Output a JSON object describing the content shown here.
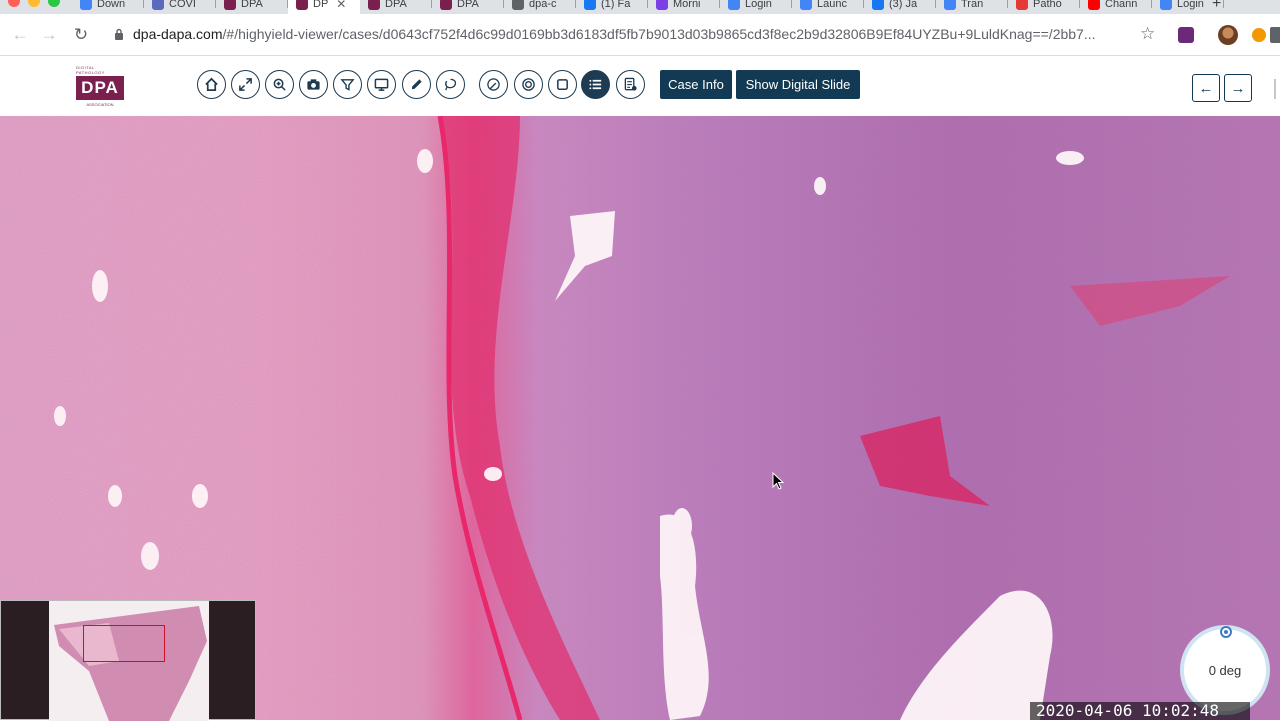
{
  "browser": {
    "tabs": [
      {
        "label": "Down",
        "color": "#4285f4"
      },
      {
        "label": "COVI",
        "color": "#5b6abf"
      },
      {
        "label": "DPA",
        "color": "#7a1f4e"
      },
      {
        "label": "DP",
        "color": "#7a1f4e",
        "active": true
      },
      {
        "label": "DPA",
        "color": "#7a1f4e"
      },
      {
        "label": "DPA",
        "color": "#7a1f4e"
      },
      {
        "label": "dpa-c",
        "color": "#5f6368"
      },
      {
        "label": "(1) Fa",
        "color": "#1877f2"
      },
      {
        "label": "Morni",
        "color": "#7b3fe4"
      },
      {
        "label": "Login",
        "color": "#4285f4"
      },
      {
        "label": "Launc",
        "color": "#4285f4"
      },
      {
        "label": "(3) Ja",
        "color": "#1877f2"
      },
      {
        "label": "Tran",
        "color": "#4285f4"
      },
      {
        "label": "Patho",
        "color": "#e53935"
      },
      {
        "label": "Chann",
        "color": "#ff0000"
      },
      {
        "label": "Login",
        "color": "#4285f4"
      }
    ],
    "new_tab": "+",
    "close_glyph": "✕",
    "url_domain": "dpa-dapa.com",
    "url_path": "/#/highyield-viewer/cases/d0643cf752f4d6c99d0169bb3d6183df5fb7b9013d03b9865cd3f8ec2b9d32806B9Ef84UYZBu+9LuldKnag==/2bb7..."
  },
  "viewer": {
    "logo": {
      "top": "DIGITAL PATHOLOGY",
      "main": "DPA",
      "bottom": "ASSOCIATION"
    },
    "tools": [
      {
        "name": "home-icon"
      },
      {
        "name": "expand-icon"
      },
      {
        "name": "zoom-icon"
      },
      {
        "name": "camera-icon"
      },
      {
        "name": "filter-icon"
      },
      {
        "name": "monitor-icon"
      },
      {
        "name": "pencil-icon"
      },
      {
        "name": "lasso-icon"
      },
      {
        "name": "draw-icon"
      },
      {
        "name": "target-icon"
      },
      {
        "name": "square-icon"
      },
      {
        "name": "list-icon",
        "active": true
      },
      {
        "name": "report-icon"
      }
    ],
    "case_info_label": "Case Info",
    "show_slide_label": "Show Digital Slide",
    "prev_glyph": "←",
    "next_glyph": "→",
    "rotation_label": "0 deg",
    "timestamp": "2020-04-06 10:02:48"
  }
}
